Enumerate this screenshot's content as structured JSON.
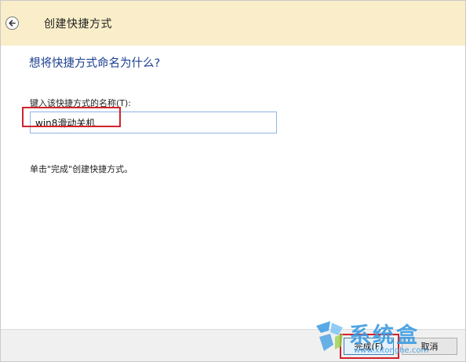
{
  "titlebar": {
    "title": "创建快捷方式",
    "back_icon": "back-arrow-icon"
  },
  "main": {
    "heading": "想将快捷方式命名为什么?",
    "field_label": "键入该快捷方式的名称(T):",
    "name_value": "win8滑动关机",
    "hint": "单击\"完成\"创建快捷方式。"
  },
  "footer": {
    "finish_label": "完成(F)",
    "cancel_label": "取消"
  },
  "watermark": {
    "text": "系统盒",
    "url": "www.xitonghe.com"
  },
  "colors": {
    "titlebar_bg": "#f9eec9",
    "heading": "#1b3f8f",
    "highlight": "#d1232a",
    "watermark": "#3a9be3"
  }
}
